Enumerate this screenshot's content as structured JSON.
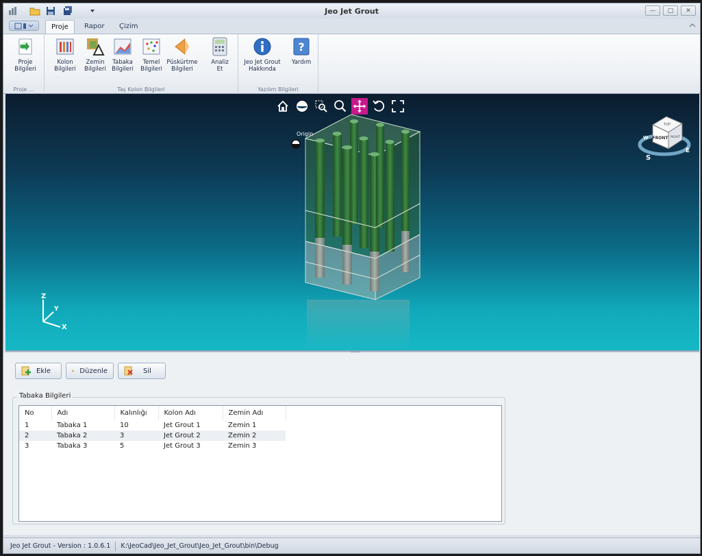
{
  "window": {
    "title": "Jeo Jet Grout"
  },
  "tabs": [
    "Proje",
    "Rapor",
    "Çizim"
  ],
  "ribbon": {
    "groups": [
      {
        "label": "Proje ...",
        "buttons": [
          "Proje\nBilgileri"
        ]
      },
      {
        "label": "Taş Kolon Bilgileri",
        "buttons": [
          "Kolon\nBilgileri",
          "Zemin\nBilgileri",
          "Tabaka\nBilgileri",
          "Temel\nBilgileri",
          "Püskürtme\nBilgileri",
          "Analiz\nEt"
        ]
      },
      {
        "label": "Yazılım Bilgileri",
        "buttons": [
          "Jeo Jet Grout\nHakkında",
          "Yardım"
        ]
      }
    ]
  },
  "viewport": {
    "origin_label": "Origin",
    "axis_labels": {
      "z": "Z",
      "y": "Y",
      "x": "X"
    },
    "viewcube": {
      "top": "TOP",
      "front": "FRONT",
      "right": "RIGHT",
      "compass_s": "S",
      "compass_e": "E",
      "compass_w": "W"
    },
    "active_tool": "pan"
  },
  "actions": {
    "add": "Ekle",
    "edit": "Düzenle",
    "delete": "Sil"
  },
  "table": {
    "title": "Tabaka Bilgileri",
    "headers": [
      "No",
      "Adı",
      "Kalınlığı",
      "Kolon Adı",
      "Zemin Adı"
    ],
    "rows": [
      [
        "1",
        "Tabaka 1",
        "10",
        "Jet Grout 1",
        "Zemin 1"
      ],
      [
        "2",
        "Tabaka 2",
        "3",
        "Jet Grout 2",
        "Zemin 2"
      ],
      [
        "3",
        "Tabaka 3",
        "5",
        "Jet Grout 3",
        "Zemin 3"
      ]
    ]
  },
  "status": {
    "version": "Jeo Jet Grout - Version : 1.0.6.1",
    "path": "K:\\JeoCad\\Jeo_Jet_Grout\\Jeo_Jet_Grout\\bin\\Debug"
  },
  "colors": {
    "accent_tool": "#c8198c",
    "column_green": "#2f6b35",
    "viewport_top": "#0c1c2e",
    "viewport_bottom": "#16b8c6"
  }
}
